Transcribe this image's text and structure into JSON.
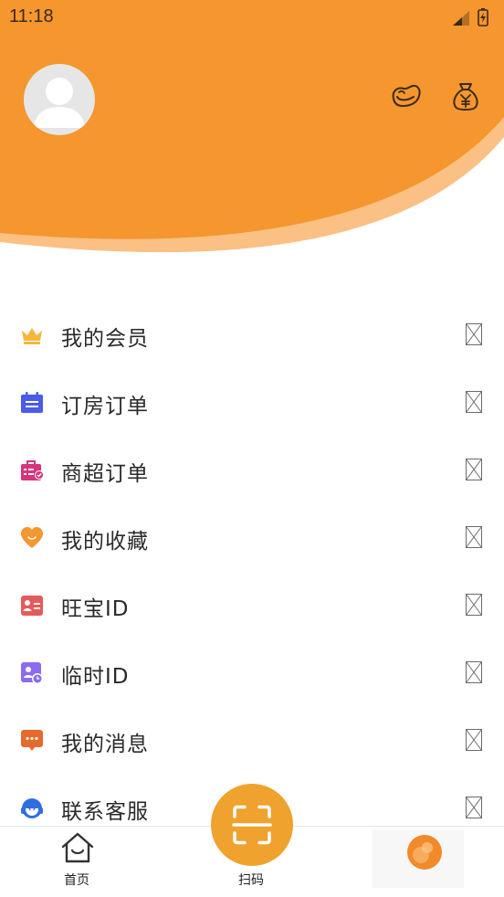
{
  "status_bar": {
    "time": "11:18"
  },
  "header": {
    "colors": {
      "primary": "#f5962f",
      "secondary": "#fbc083"
    },
    "icons": [
      "beans-icon",
      "money-bag-icon"
    ]
  },
  "menu": {
    "items": [
      {
        "label": "我的会员",
        "icon": "crown-icon",
        "color": "#f3b63d"
      },
      {
        "label": "订房订单",
        "icon": "calendar-icon",
        "color": "#4a5ce8"
      },
      {
        "label": "商超订单",
        "icon": "shopping-bag-icon",
        "color": "#d8337e"
      },
      {
        "label": "我的收藏",
        "icon": "heart-icon",
        "color": "#f5962f"
      },
      {
        "label": "旺宝ID",
        "icon": "id-card-icon",
        "color": "#e55a5a"
      },
      {
        "label": "临时ID",
        "icon": "temp-id-icon",
        "color": "#8b6cf0"
      },
      {
        "label": "我的消息",
        "icon": "message-icon",
        "color": "#e7692c"
      },
      {
        "label": "联系客服",
        "icon": "customer-service-icon",
        "color": "#2f6fe0"
      }
    ],
    "trailing_icon": "missing-image-icon"
  },
  "tabbar": {
    "home_label": "首页",
    "scan_label": "扫码"
  }
}
